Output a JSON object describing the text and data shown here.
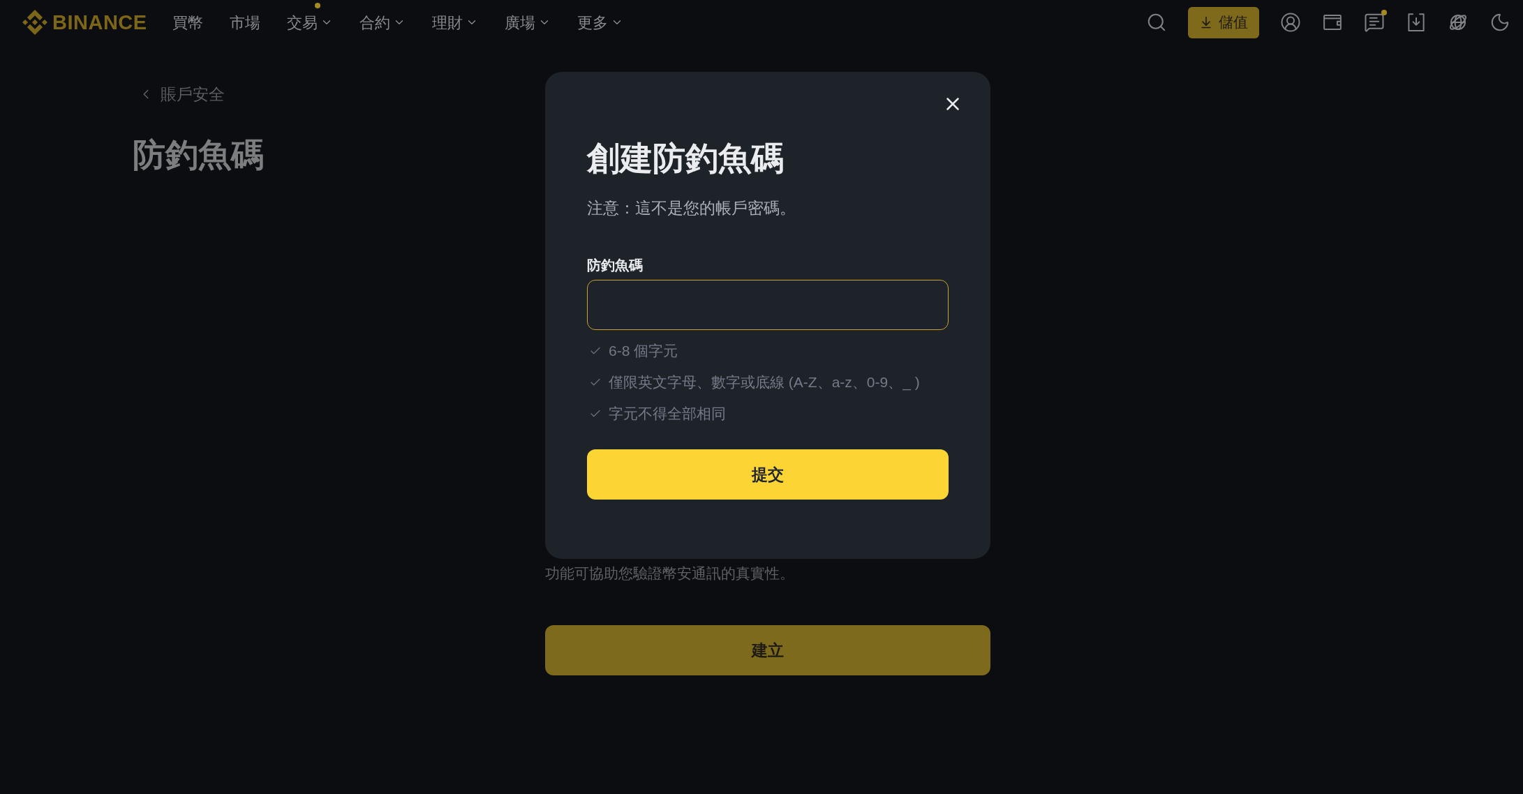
{
  "nav": {
    "logo": "BINANCE",
    "items": [
      {
        "label": "買幣",
        "has_menu": false,
        "dot": false
      },
      {
        "label": "市場",
        "has_menu": false,
        "dot": false
      },
      {
        "label": "交易",
        "has_menu": true,
        "dot": true
      },
      {
        "label": "合約",
        "has_menu": true,
        "dot": false
      },
      {
        "label": "理財",
        "has_menu": true,
        "dot": false
      },
      {
        "label": "廣場",
        "has_menu": true,
        "dot": false
      },
      {
        "label": "更多",
        "has_menu": true,
        "dot": false
      }
    ],
    "deposit_button": "儲值",
    "messages_dot": true
  },
  "page": {
    "back_link": "賬戶安全",
    "title": "防釣魚碼",
    "description": "功能可協助您驗證幣安通訊的真實性。",
    "create_button": "建立"
  },
  "modal": {
    "title": "創建防釣魚碼",
    "notice": "注意：這不是您的帳戶密碼。",
    "field": {
      "label": "防釣魚碼",
      "focused": true
    },
    "requirements": [
      {
        "text": "6-8 個字元",
        "met": false
      },
      {
        "text": "僅限英文字母、數字或底線 (A-Z、a-z、0-9、_ )",
        "met": false
      },
      {
        "text": "字元不得全部相同",
        "met": false
      }
    ],
    "submit_button": "提交"
  }
}
